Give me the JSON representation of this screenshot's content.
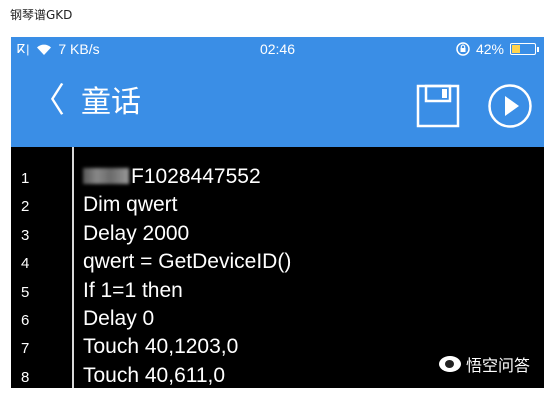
{
  "caption": "钢琴谱GKD",
  "status_bar": {
    "signal_text": "ⴽ|",
    "wifi_icon": "wifi-icon",
    "network_speed": "7 KB/s",
    "time": "02:46",
    "battery_percent": "42%",
    "battery_level": 0.42
  },
  "app_bar": {
    "back_label": "〈",
    "title": "童话",
    "save_icon": "floppy-disk-icon",
    "play_icon": "play-icon"
  },
  "editor": {
    "lines": [
      {
        "num": "1",
        "code": "F1028447552"
      },
      {
        "num": "2",
        "code": "Dim qwert"
      },
      {
        "num": "3",
        "code": "Delay 2000"
      },
      {
        "num": "4",
        "code": "qwert = GetDeviceID()"
      },
      {
        "num": "5",
        "code": "If 1=1 then"
      },
      {
        "num": "6",
        "code": "Delay 0"
      },
      {
        "num": "7",
        "code": "Touch 40,1203,0"
      },
      {
        "num": "8",
        "code": "Touch 40,611,0"
      }
    ]
  },
  "watermark": {
    "text": "悟空问答"
  },
  "colors": {
    "app_blue": "#3a8ee6",
    "editor_bg": "#000000",
    "battery_fill": "#ffd34d"
  }
}
